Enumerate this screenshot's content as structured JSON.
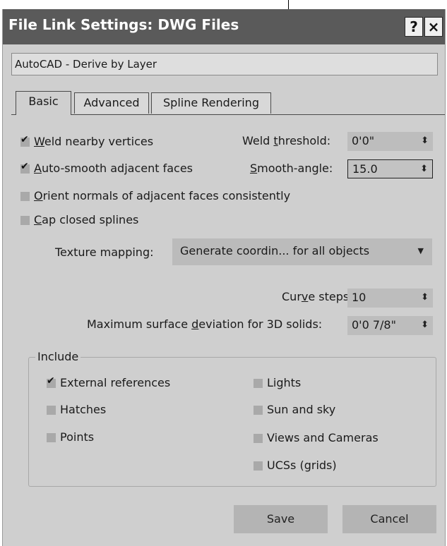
{
  "window": {
    "title": "File Link Settings: DWG Files",
    "help_label": "?",
    "close_label": "×"
  },
  "preset": "AutoCAD - Derive by Layer",
  "tabs": [
    {
      "label": "Basic",
      "active": true
    },
    {
      "label": "Advanced",
      "active": false
    },
    {
      "label": "Spline Rendering",
      "active": false
    }
  ],
  "basic": {
    "weld_vertices": {
      "pre": "",
      "key": "W",
      "post": "eld nearby vertices",
      "checked": true
    },
    "weld_threshold": {
      "pre": "Weld ",
      "key": "t",
      "post": "hreshold:",
      "value": "0'0\""
    },
    "auto_smooth": {
      "pre": "",
      "key": "A",
      "post": "uto-smooth adjacent faces",
      "checked": true
    },
    "smooth_angle": {
      "pre": "",
      "key": "S",
      "post": "mooth-angle:",
      "value": "15.0"
    },
    "orient_normals": {
      "pre": "",
      "key": "O",
      "post": "rient normals of adjacent faces consistently",
      "checked": false
    },
    "cap_splines": {
      "pre": "",
      "key": "C",
      "post": "ap closed splines",
      "checked": false
    },
    "texture_mapping": {
      "label": "Texture mapping:",
      "value": "Generate coordin... for all objects"
    },
    "curve_steps": {
      "pre": "Cur",
      "key": "v",
      "post": "e steps:",
      "value": "10"
    },
    "max_deviation": {
      "pre": "Maximum surface ",
      "key": "d",
      "post": "eviation for 3D solids:",
      "value": "0'0 7/8\""
    }
  },
  "include": {
    "title": "Include",
    "left": [
      {
        "label": "External references",
        "checked": true
      },
      {
        "label": "Hatches",
        "checked": false
      },
      {
        "label": "Points",
        "checked": false
      }
    ],
    "right": [
      {
        "label": "Lights",
        "checked": false
      },
      {
        "label": "Sun and sky",
        "checked": false
      },
      {
        "label": "Views and Cameras",
        "checked": false
      },
      {
        "label": "UCSs (grids)",
        "checked": false
      }
    ]
  },
  "buttons": {
    "save": "Save",
    "cancel": "Cancel"
  },
  "glyphs": {
    "check": "✔",
    "spin": "⬍",
    "dropdown": "▼"
  },
  "colors": {
    "titlebar": "#5a5a5a",
    "dialog_bg": "#cfcfcf",
    "checkbox": "#a9a9a9"
  }
}
